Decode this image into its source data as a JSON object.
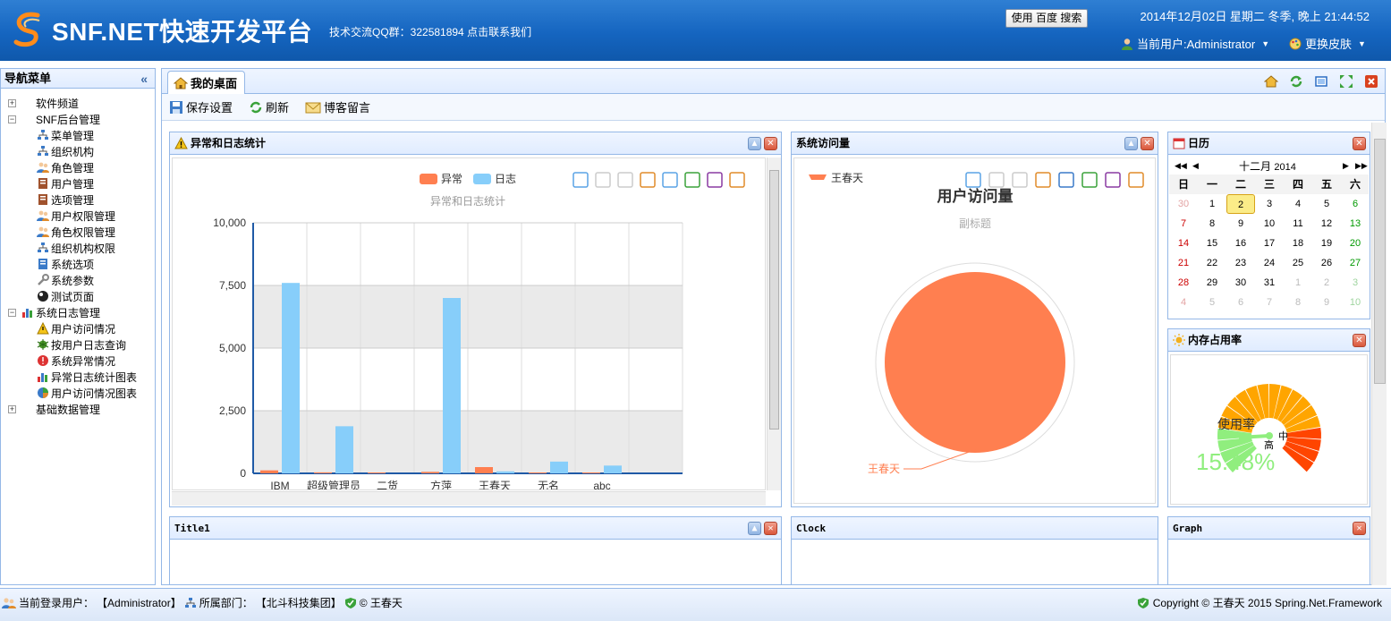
{
  "header": {
    "title": "SNF.NET快速开发平台",
    "qq_text": "技术交流QQ群：322581894 点击联系我们",
    "search_button": "使用 百度 搜索",
    "datetime": "2014年12月02日 星期二 冬季, 晚上 21:44:52",
    "current_user": "当前用户:Administrator",
    "skin": "更换皮肤",
    "brand_color": "#1565c0"
  },
  "nav": {
    "title": "导航菜单",
    "collapse_icon": "«",
    "items": [
      {
        "label": "软件频道",
        "level": 1,
        "toggle": "+"
      },
      {
        "label": "SNF后台管理",
        "level": 1,
        "toggle": "−"
      },
      {
        "label": "菜单管理",
        "level": 2,
        "icon": "sitemap-icon"
      },
      {
        "label": "组织机构",
        "level": 2,
        "icon": "org-icon"
      },
      {
        "label": "角色管理",
        "level": 2,
        "icon": "role-icon"
      },
      {
        "label": "用户管理",
        "level": 2,
        "icon": "user-book-icon"
      },
      {
        "label": "选项管理",
        "level": 2,
        "icon": "option-book-icon"
      },
      {
        "label": "用户权限管理",
        "level": 2,
        "icon": "users-icon"
      },
      {
        "label": "角色权限管理",
        "level": 2,
        "icon": "role-icon"
      },
      {
        "label": "组织机构权限",
        "level": 2,
        "icon": "org-icon"
      },
      {
        "label": "系统选项",
        "level": 2,
        "icon": "doc-icon"
      },
      {
        "label": "系统参数",
        "level": 2,
        "icon": "wrench-icon"
      },
      {
        "label": "测试页面",
        "level": 2,
        "icon": "ball-icon"
      },
      {
        "label": "系统日志管理",
        "level": 1,
        "toggle": "−",
        "icon": "chart-icon"
      },
      {
        "label": "用户访问情况",
        "level": 2,
        "icon": "warning-icon"
      },
      {
        "label": "按用户日志查询",
        "level": 2,
        "icon": "bug-icon"
      },
      {
        "label": "系统异常情况",
        "level": 2,
        "icon": "error-icon"
      },
      {
        "label": "异常日志统计图表",
        "level": 2,
        "icon": "chart-icon"
      },
      {
        "label": "用户访问情况图表",
        "level": 2,
        "icon": "pie-icon"
      },
      {
        "label": "基础数据管理",
        "level": 1,
        "toggle": "+"
      }
    ]
  },
  "tabs": {
    "active": "我的桌面",
    "toolbar": {
      "save": "保存设置",
      "refresh": "刷新",
      "blog": "博客留言"
    }
  },
  "panels": {
    "exception": {
      "title": "异常和日志统计",
      "chart_title": "异常和日志统计",
      "legend": [
        "异常",
        "日志"
      ]
    },
    "visit": {
      "title": "系统访问量",
      "chart_title": "用户访问量",
      "subtitle": "副标题",
      "legend": "王春天",
      "slice_label": "王春天"
    },
    "calendar": {
      "title": "日历",
      "month": "十二月",
      "year": "2014",
      "weekdays": [
        "日",
        "一",
        "二",
        "三",
        "四",
        "五",
        "六"
      ],
      "days": [
        "30",
        "1",
        "2",
        "3",
        "4",
        "5",
        "6",
        "7",
        "8",
        "9",
        "10",
        "11",
        "12",
        "13",
        "14",
        "15",
        "16",
        "17",
        "18",
        "19",
        "20",
        "21",
        "22",
        "23",
        "24",
        "25",
        "26",
        "27",
        "28",
        "29",
        "30",
        "31",
        "1",
        "2",
        "3",
        "4",
        "5",
        "6",
        "7",
        "8",
        "9",
        "10"
      ],
      "today": "2"
    },
    "memory": {
      "title": "内存占用率",
      "gauge_label": "使用率",
      "gauge_value": "15.48%",
      "gauge_level": "中",
      "gauge_level2": "高"
    },
    "title1": {
      "title": "Title1"
    },
    "clock": {
      "title": "Clock"
    },
    "graph": {
      "title": "Graph"
    }
  },
  "footer": {
    "user_label": "当前登录用户：",
    "user": "【Administrator】",
    "dept_label": "所属部门：",
    "dept": "【北斗科技集团】",
    "author": "© 王春天",
    "copyright": "Copyright © 王春天 2015 Spring.Net.Framework"
  },
  "chart_data": [
    {
      "type": "bar",
      "title": "异常和日志统计",
      "categories": [
        "IBM",
        "超级管理员",
        "二货",
        "方萍",
        "王春天",
        "无名",
        "abc",
        ""
      ],
      "series": [
        {
          "name": "异常",
          "values": [
            120,
            40,
            20,
            60,
            250,
            30,
            10,
            0
          ],
          "color": "#ff7f50"
        },
        {
          "name": "日志",
          "values": [
            7600,
            1880,
            0,
            7000,
            80,
            470,
            310,
            0
          ],
          "color": "#87cefa"
        }
      ],
      "yticks": [
        "0",
        "2,500",
        "5,000",
        "7,500",
        "10,000"
      ],
      "ylim": [
        0,
        10000
      ],
      "grid": true,
      "legend_position": "top"
    },
    {
      "type": "pie",
      "title": "用户访问量",
      "subtitle": "副标题",
      "slices": [
        {
          "name": "王春天",
          "value": 100,
          "color": "#ff7f50"
        }
      ],
      "legend_position": "top-left"
    }
  ]
}
